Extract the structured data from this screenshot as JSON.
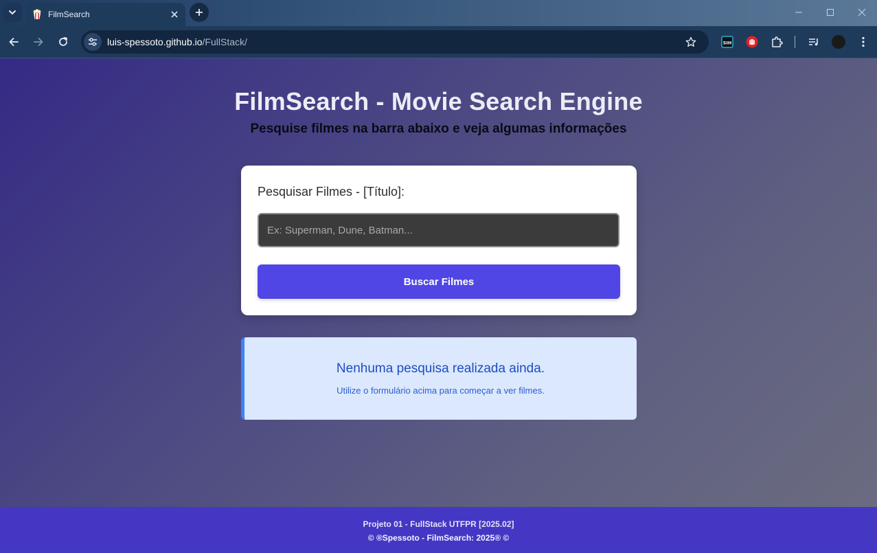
{
  "browser": {
    "tab_title": "FilmSearch",
    "url_host": "luis-spessoto.github.io",
    "url_path": "/FullStack/",
    "icons": {
      "tab_search": "chevron-down-icon",
      "favicon": "popcorn-icon",
      "tab_close": "close-icon",
      "new_tab": "plus-icon",
      "back": "arrow-left-icon",
      "forward": "arrow-right-icon",
      "reload": "reload-icon",
      "site_info": "tune-icon",
      "bookmark": "star-icon",
      "extension_1": "sih-icon",
      "extension_2": "hand-stop-icon",
      "extensions": "puzzle-icon",
      "media": "playlist-icon",
      "profile": "avatar-icon",
      "menu": "kebab-menu-icon"
    }
  },
  "page": {
    "title": "FilmSearch - Movie Search Engine",
    "subtitle": "Pesquise filmes na barra abaixo e veja algumas informações",
    "search": {
      "label": "Pesquisar Filmes - [Título]:",
      "placeholder": "Ex: Superman, Dune, Batman...",
      "value": "",
      "button_label": "Buscar Filmes"
    },
    "status": {
      "title": "Nenhuma pesquisa realizada ainda.",
      "message": "Utilize o formulário acima para começar a ver filmes."
    },
    "footer": {
      "line1": "Projeto 01 - FullStack UTFPR [2025.02]",
      "line2": "© ®Spessoto - FilmSearch: 2025® ©"
    }
  },
  "colors": {
    "accent": "#4f46e5",
    "footer_bg": "#4437c4",
    "info_bg": "#dbe8fd",
    "info_border": "#3b82f6",
    "info_title": "#1d4ec0"
  }
}
